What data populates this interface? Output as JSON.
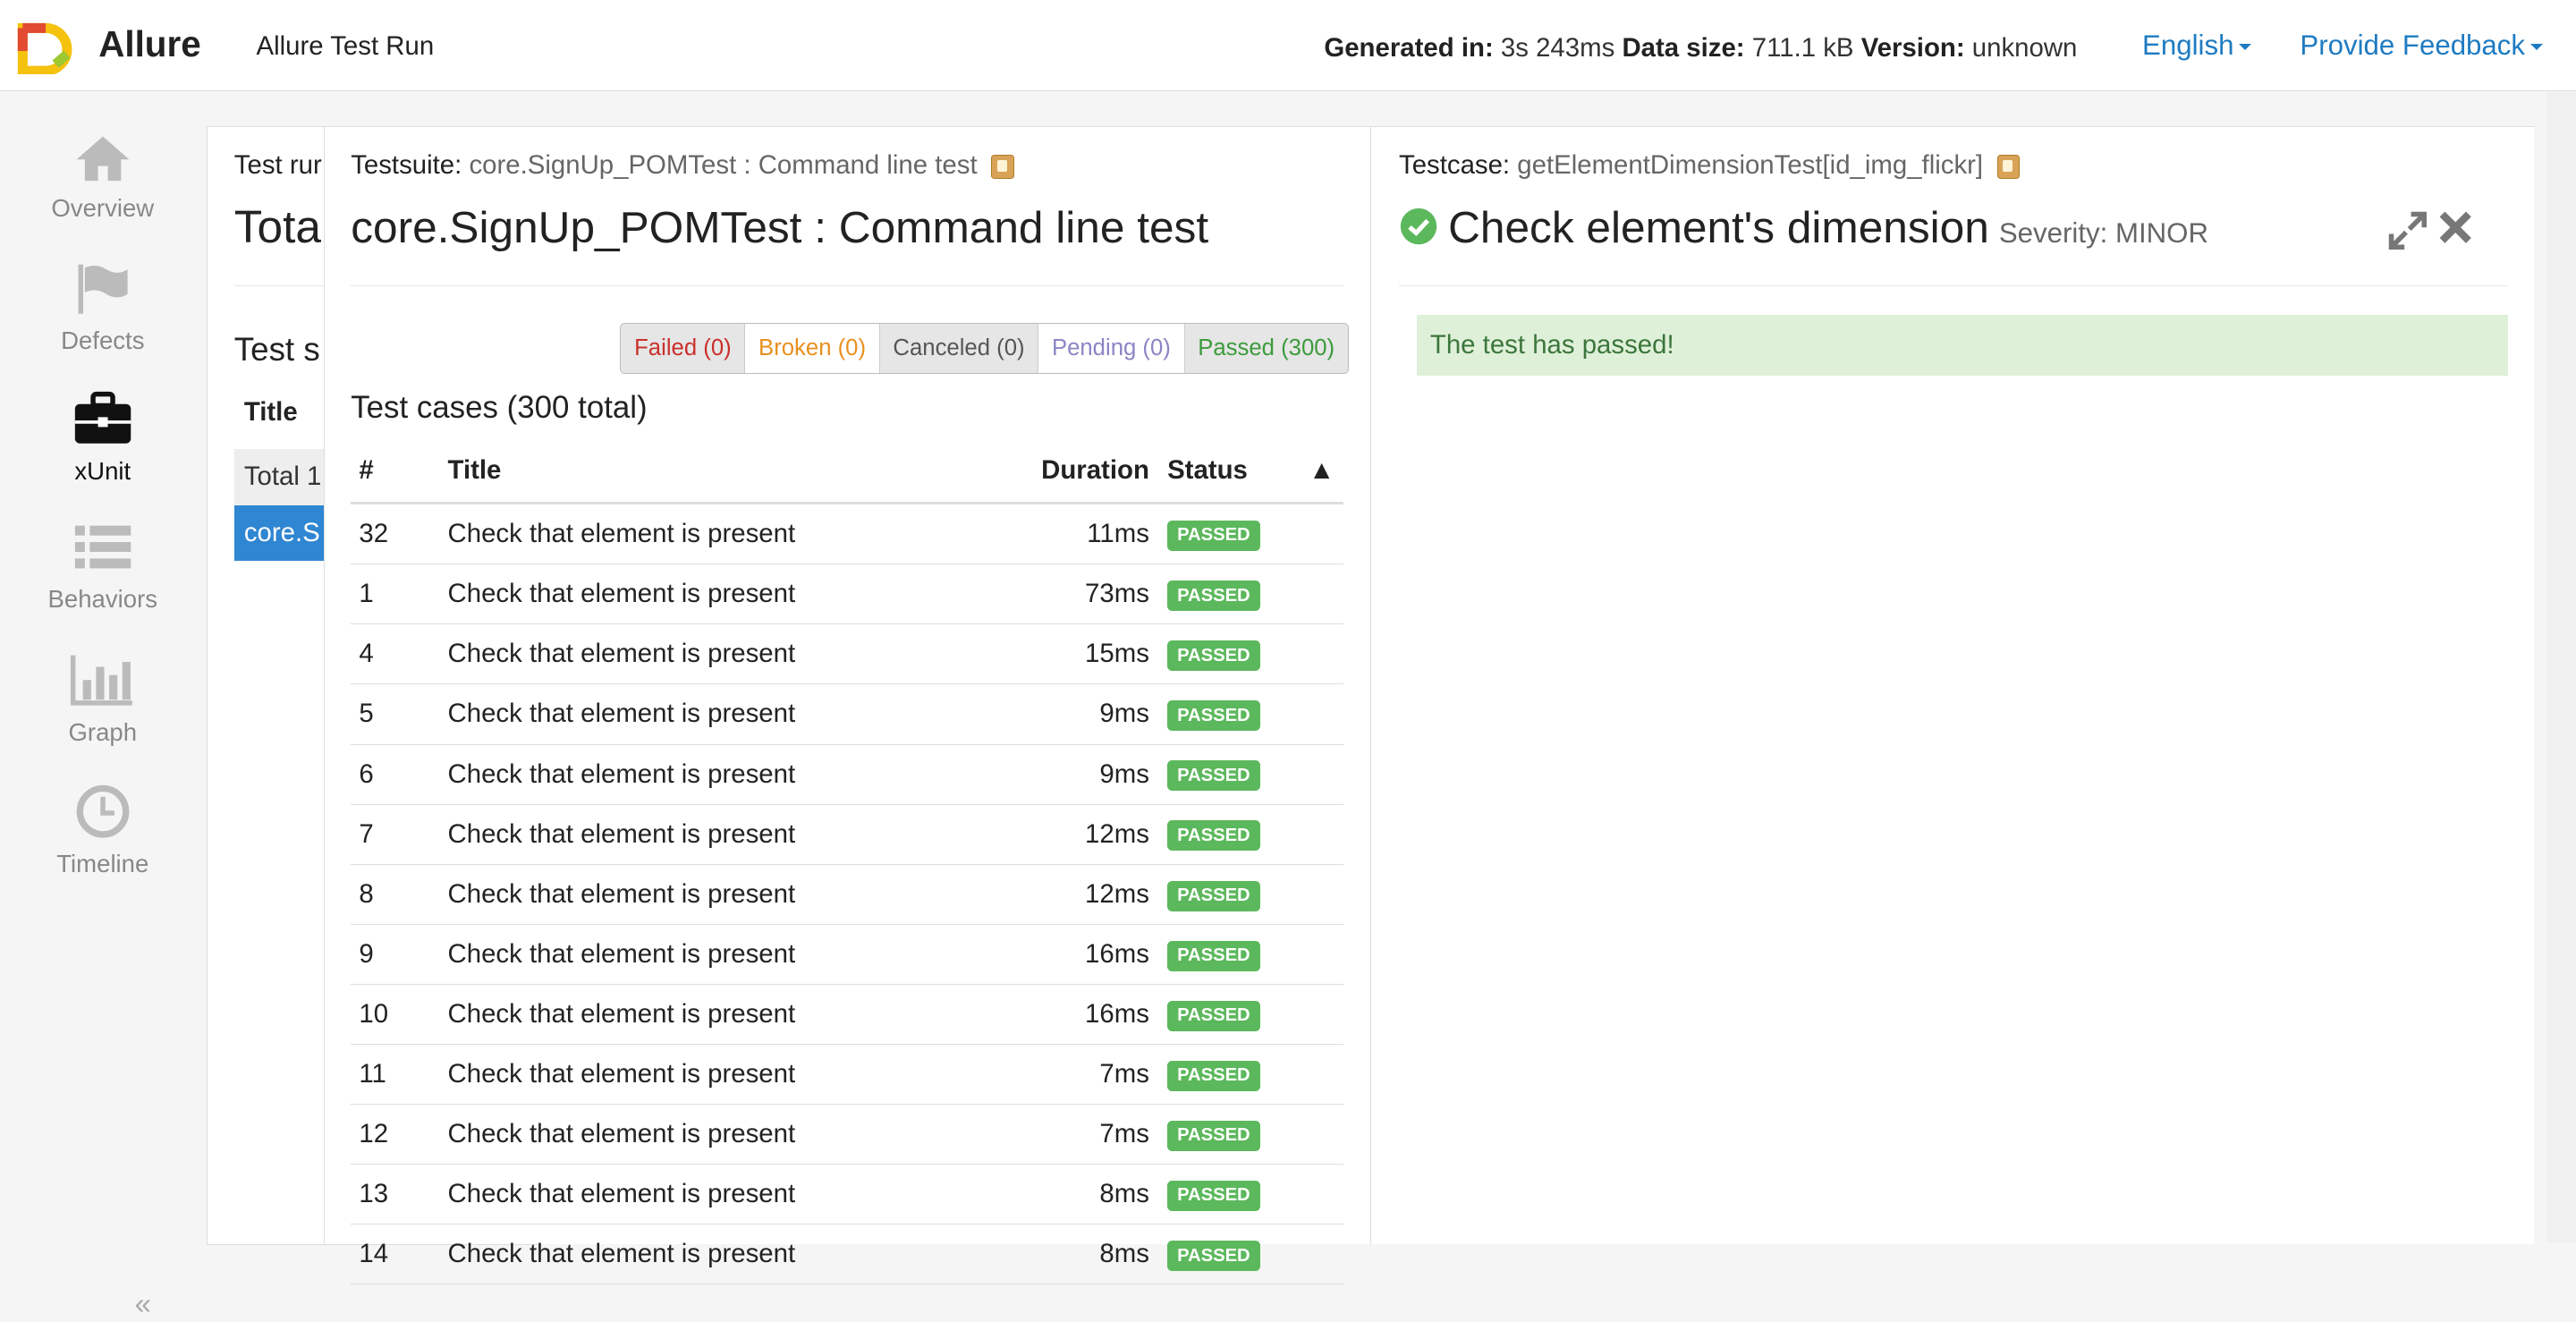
{
  "header": {
    "brand": "Allure",
    "run_name": "Allure Test Run",
    "generated_label": "Generated in:",
    "generated_value": "3s 243ms",
    "size_label": "Data size:",
    "size_value": "711.1 kB",
    "version_label": "Version:",
    "version_value": "unknown",
    "language": "English",
    "feedback": "Provide Feedback"
  },
  "sidebar": {
    "items": [
      {
        "label": "Overview",
        "icon": "home-icon"
      },
      {
        "label": "Defects",
        "icon": "flag-icon"
      },
      {
        "label": "xUnit",
        "icon": "briefcase-icon",
        "active": true
      },
      {
        "label": "Behaviors",
        "icon": "list-icon"
      },
      {
        "label": "Graph",
        "icon": "bar-chart-icon"
      },
      {
        "label": "Timeline",
        "icon": "clock-icon"
      }
    ],
    "collapse": "«"
  },
  "background_panel": {
    "title": "Test rur",
    "total": "Total",
    "section": "Test s",
    "col_title": "Title",
    "row_total": "Total 1",
    "row_selected": "core.S"
  },
  "suite": {
    "label": "Testsuite:",
    "name": "core.SignUp_POMTest : Command line test",
    "heading": "core.SignUp_POMTest : Command line test",
    "filters": {
      "failed": "Failed (0)",
      "broken": "Broken (0)",
      "canceled": "Canceled (0)",
      "pending": "Pending (0)",
      "passed": "Passed (300)"
    },
    "cases_title": "Test cases (300 total)",
    "columns": {
      "num": "#",
      "title": "Title",
      "duration": "Duration",
      "status": "Status",
      "sort": "▲"
    },
    "rows": [
      {
        "num": "32",
        "title": "Check that element is present",
        "duration": "11ms",
        "status": "PASSED"
      },
      {
        "num": "1",
        "title": "Check that element is present",
        "duration": "73ms",
        "status": "PASSED"
      },
      {
        "num": "4",
        "title": "Check that element is present",
        "duration": "15ms",
        "status": "PASSED"
      },
      {
        "num": "5",
        "title": "Check that element is present",
        "duration": "9ms",
        "status": "PASSED"
      },
      {
        "num": "6",
        "title": "Check that element is present",
        "duration": "9ms",
        "status": "PASSED"
      },
      {
        "num": "7",
        "title": "Check that element is present",
        "duration": "12ms",
        "status": "PASSED"
      },
      {
        "num": "8",
        "title": "Check that element is present",
        "duration": "12ms",
        "status": "PASSED"
      },
      {
        "num": "9",
        "title": "Check that element is present",
        "duration": "16ms",
        "status": "PASSED"
      },
      {
        "num": "10",
        "title": "Check that element is present",
        "duration": "16ms",
        "status": "PASSED"
      },
      {
        "num": "11",
        "title": "Check that element is present",
        "duration": "7ms",
        "status": "PASSED"
      },
      {
        "num": "12",
        "title": "Check that element is present",
        "duration": "7ms",
        "status": "PASSED"
      },
      {
        "num": "13",
        "title": "Check that element is present",
        "duration": "8ms",
        "status": "PASSED"
      },
      {
        "num": "14",
        "title": "Check that element is present",
        "duration": "8ms",
        "status": "PASSED"
      }
    ]
  },
  "testcase": {
    "label": "Testcase:",
    "name": "getElementDimensionTest[id_img_flickr]",
    "title": "Check element's dimension",
    "severity": "Severity: MINOR",
    "message": "The test has passed!"
  },
  "colors": {
    "accent": "#1e7bc2",
    "passed": "#5cb85c",
    "failed": "#c9302c",
    "broken": "#e8901e",
    "pending": "#8a85c4",
    "selected_row": "#2f86d2"
  }
}
